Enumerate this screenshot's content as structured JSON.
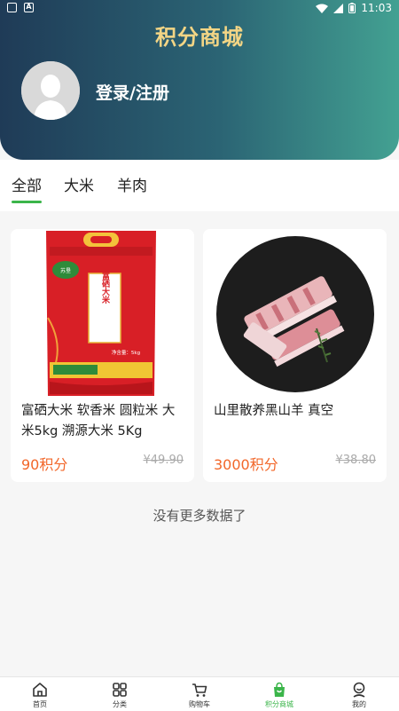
{
  "status_bar": {
    "time": "11:03"
  },
  "header": {
    "title": "积分商城",
    "login_text": "登录/注册"
  },
  "tabs": [
    {
      "label": "全部",
      "active": true
    },
    {
      "label": "大米",
      "active": false
    },
    {
      "label": "羊肉",
      "active": false
    }
  ],
  "products": [
    {
      "title": "富硒大米 软香米 圆粒米 大米5kg 溯源大米 5Kg",
      "price": "90积分",
      "original_price": "¥49.90",
      "image": "rice-bag"
    },
    {
      "title": "山里散养黑山羊 真空",
      "price": "3000积分",
      "original_price": "¥38.80",
      "image": "lamb-ribs-plate"
    }
  ],
  "rice_bag_text": {
    "brand": "富硒大米",
    "logo": "苏垦",
    "weight": "净含量：5kg"
  },
  "footer_text": "没有更多数据了",
  "tabbar": [
    {
      "label": "首页",
      "icon": "home-icon"
    },
    {
      "label": "分类",
      "icon": "grid-icon"
    },
    {
      "label": "购物车",
      "icon": "cart-icon"
    },
    {
      "label": "积分商城",
      "icon": "points-mall-icon",
      "active": true
    },
    {
      "label": "我的",
      "icon": "profile-icon"
    }
  ],
  "colors": {
    "accent_green": "#3bb54a",
    "price_orange": "#f2672a",
    "title_gold": "#f3d585"
  }
}
